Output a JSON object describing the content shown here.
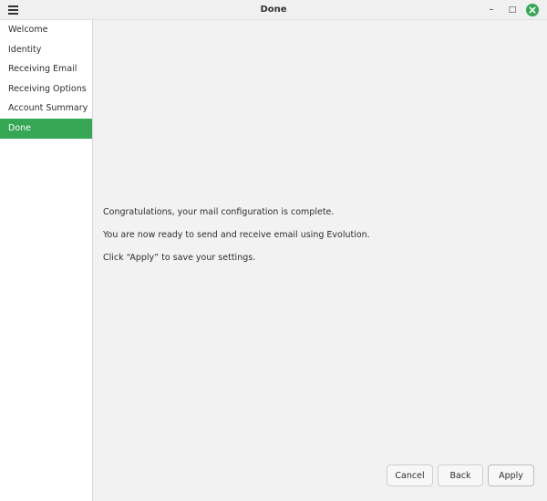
{
  "window": {
    "title": "Done",
    "minimize_glyph": "–",
    "maximize_glyph": "□",
    "close_glyph": "✕"
  },
  "sidebar": {
    "items": [
      {
        "label": "Welcome",
        "active": false
      },
      {
        "label": "Identity",
        "active": false
      },
      {
        "label": "Receiving Email",
        "active": false
      },
      {
        "label": "Receiving Options",
        "active": false
      },
      {
        "label": "Account Summary",
        "active": false
      },
      {
        "label": "Done",
        "active": true
      }
    ]
  },
  "content": {
    "line1": "Congratulations, your mail configuration is complete.",
    "line2": "You are now ready to send and receive email using Evolution.",
    "line3": "Click “Apply” to save your settings."
  },
  "buttons": {
    "cancel": "Cancel",
    "back": "Back",
    "apply": "Apply"
  },
  "colors": {
    "accent": "#35a755"
  }
}
